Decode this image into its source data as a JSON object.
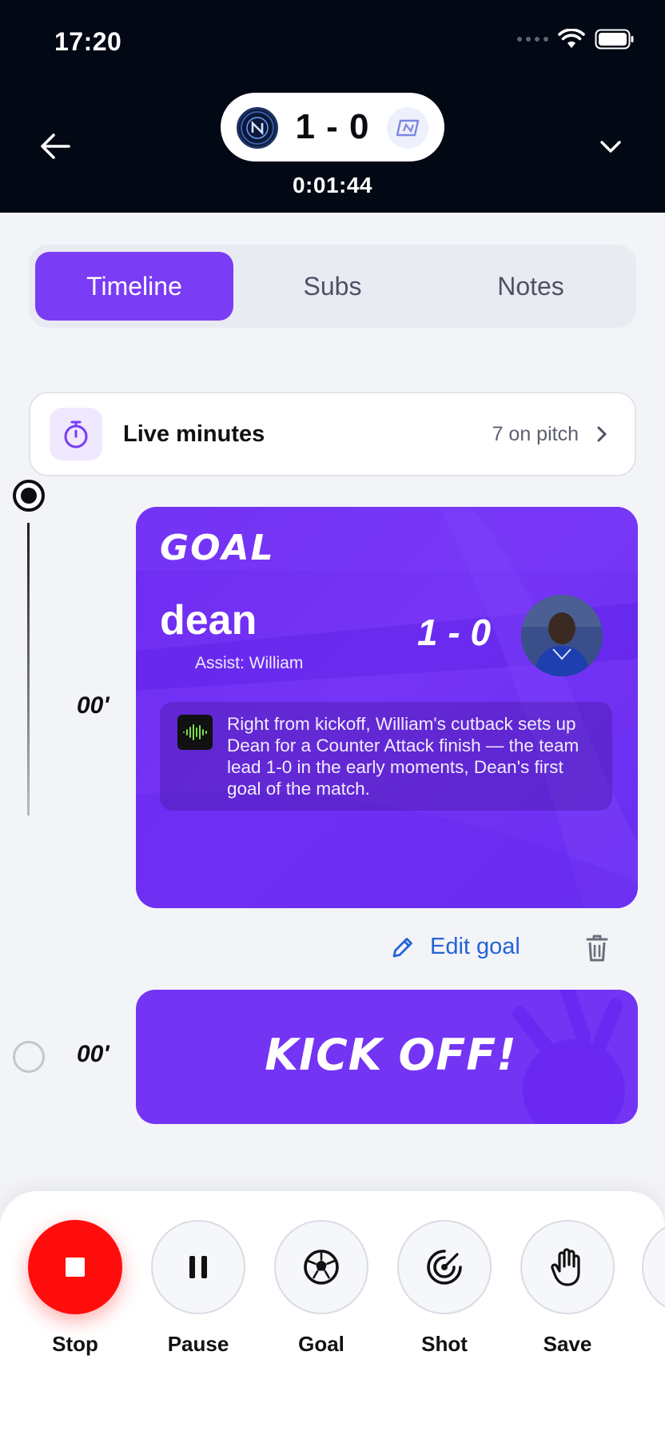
{
  "status_bar": {
    "time": "17:20"
  },
  "match": {
    "score": "1 - 0",
    "clock": "0:01:44"
  },
  "tabs": [
    {
      "label": "Timeline",
      "active": true
    },
    {
      "label": "Subs",
      "active": false
    },
    {
      "label": "Notes",
      "active": false
    }
  ],
  "live_minutes": {
    "label": "Live minutes",
    "count": "7 on pitch"
  },
  "timeline": {
    "events": [
      {
        "minute": "00'",
        "type": "GOAL",
        "scorer": "dean",
        "assist": "Assist: William",
        "score": "1 - 0",
        "commentary": "Right from kickoff, William's cutback sets up Dean for a Counter Attack finish — the team lead 1-0 in the early moments, Dean's first goal of the match."
      },
      {
        "minute": "00'",
        "type": "KICK OFF!"
      }
    ],
    "edit_label": "Edit goal"
  },
  "actions": [
    {
      "label": "Stop",
      "icon": "stop-icon"
    },
    {
      "label": "Pause",
      "icon": "pause-icon"
    },
    {
      "label": "Goal",
      "icon": "soccer-ball-icon"
    },
    {
      "label": "Shot",
      "icon": "target-icon"
    },
    {
      "label": "Save",
      "icon": "hand-icon"
    }
  ],
  "colors": {
    "accent": "#7a3cf5",
    "header": "#020814",
    "stop": "#ff0d0d",
    "link": "#2563d6"
  }
}
